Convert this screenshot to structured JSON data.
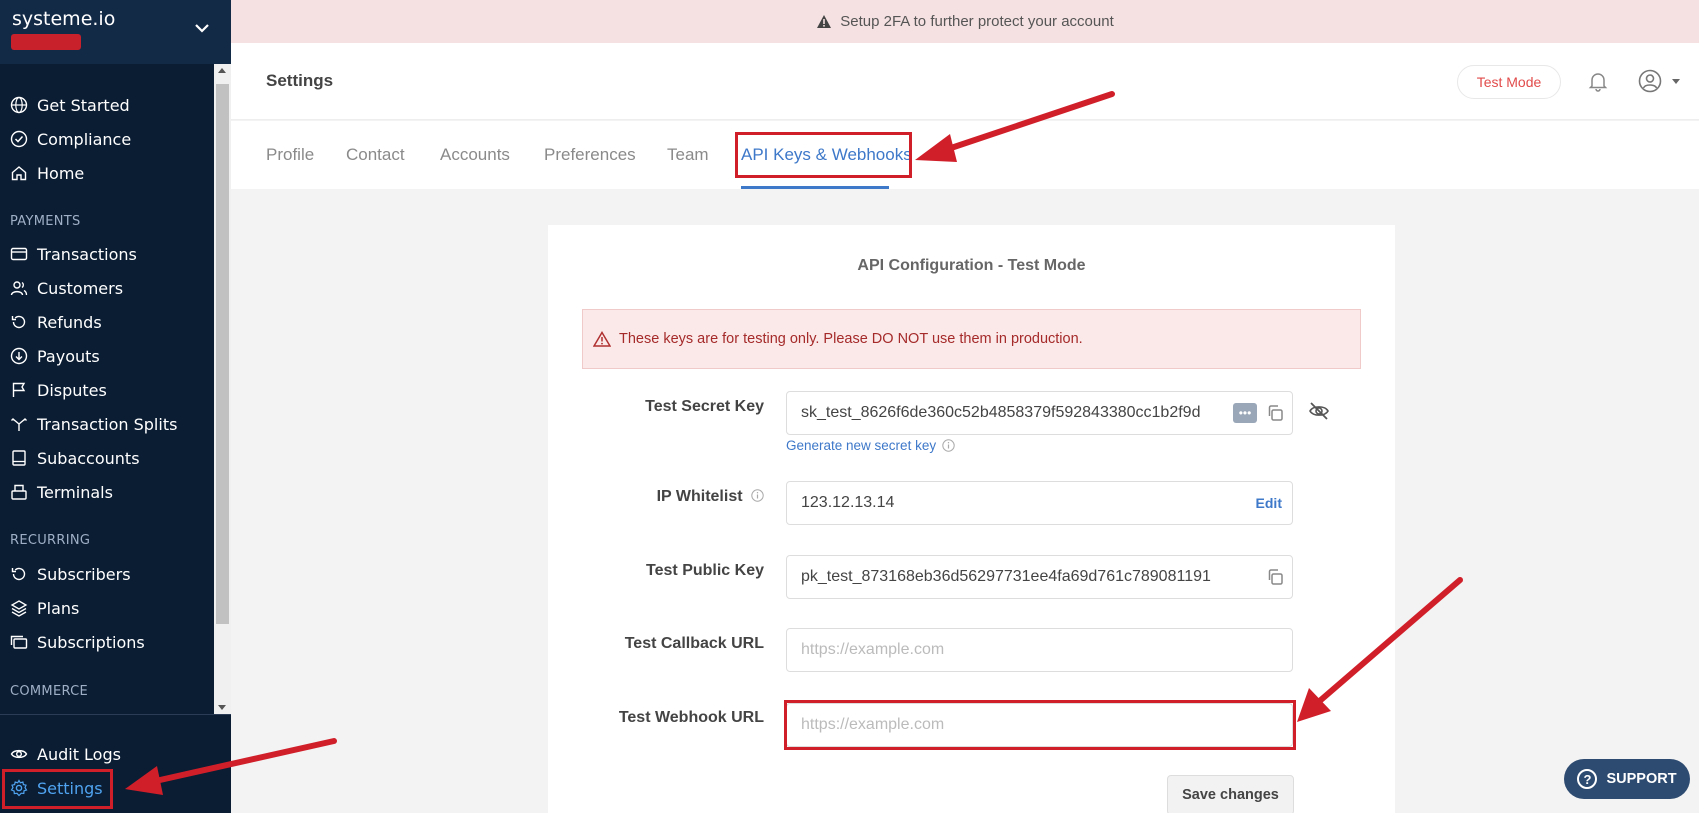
{
  "brand": {
    "name": "systeme.io"
  },
  "sidebar": {
    "top_items": [
      {
        "label": "Get Started",
        "icon": "globe-icon"
      },
      {
        "label": "Compliance",
        "icon": "check-circle-icon"
      },
      {
        "label": "Home",
        "icon": "home-icon"
      }
    ],
    "sections": {
      "payments": "PAYMENTS",
      "recurring": "RECURRING",
      "commerce": "COMMERCE"
    },
    "payment_items": [
      {
        "label": "Transactions",
        "icon": "card-icon"
      },
      {
        "label": "Customers",
        "icon": "users-icon"
      },
      {
        "label": "Refunds",
        "icon": "refund-icon"
      },
      {
        "label": "Payouts",
        "icon": "payout-icon"
      },
      {
        "label": "Disputes",
        "icon": "flag-icon"
      },
      {
        "label": "Transaction Splits",
        "icon": "split-icon"
      },
      {
        "label": "Subaccounts",
        "icon": "book-icon"
      },
      {
        "label": "Terminals",
        "icon": "terminal-icon"
      }
    ],
    "recurring_items": [
      {
        "label": "Subscribers",
        "icon": "refresh-icon"
      },
      {
        "label": "Plans",
        "icon": "layers-icon"
      },
      {
        "label": "Subscriptions",
        "icon": "cards-icon"
      }
    ],
    "bottom_items": [
      {
        "label": "Audit Logs",
        "icon": "eye-icon"
      },
      {
        "label": "Settings",
        "icon": "gear-icon",
        "active": true
      }
    ]
  },
  "banner": {
    "text": "Setup 2FA to further protect your account"
  },
  "header": {
    "title": "Settings",
    "test_mode_label": "Test Mode"
  },
  "tabs": [
    "Profile",
    "Contact",
    "Accounts",
    "Preferences",
    "Team",
    "API Keys & Webhooks"
  ],
  "active_tab": "API Keys & Webhooks",
  "card": {
    "title": "API Configuration - Test Mode",
    "alert": "These keys are for testing only. Please DO NOT use them in production.",
    "secret_key_label": "Test Secret Key",
    "secret_key_value": "sk_test_8626f6de360c52b4858379f592843380cc1b2f9d",
    "generate_link": "Generate new secret key",
    "ip_label": "IP Whitelist",
    "ip_value": "123.12.13.14",
    "ip_edit": "Edit",
    "public_key_label": "Test Public Key",
    "public_key_value": "pk_test_873168eb36d56297731ee4fa69d761c789081191",
    "callback_label": "Test Callback URL",
    "callback_placeholder": "https://example.com",
    "webhook_label": "Test Webhook URL",
    "webhook_placeholder": "https://example.com",
    "save_label": "Save changes"
  },
  "support_label": "SUPPORT",
  "colors": {
    "sidebar": "#0b1d33",
    "accent": "#3e78c9",
    "annotation": "#d11f2a",
    "danger": "#e24b4b"
  }
}
